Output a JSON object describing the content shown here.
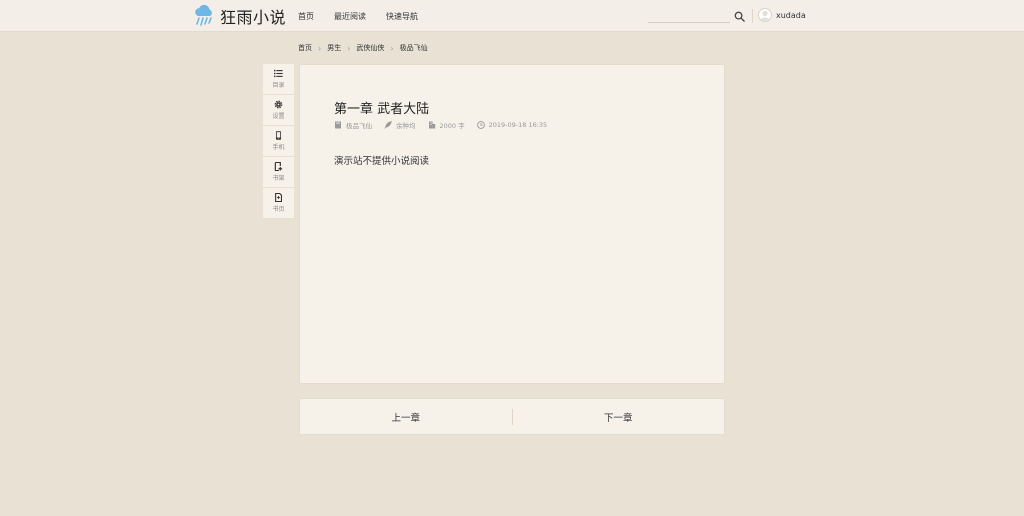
{
  "header": {
    "logo_text": "狂雨小说",
    "nav": [
      {
        "label": "首页"
      },
      {
        "label": "最近阅读"
      },
      {
        "label": "快速导航"
      }
    ],
    "search": {
      "placeholder": "",
      "value": ""
    },
    "user": {
      "name": "xudada"
    }
  },
  "breadcrumb": [
    "首页",
    "男生",
    "武侠仙侠",
    "极品飞仙"
  ],
  "sidebar": {
    "items": [
      {
        "label": "目录",
        "icon": "list-icon"
      },
      {
        "label": "设置",
        "icon": "gear-icon"
      },
      {
        "label": "手机",
        "icon": "phone-icon"
      },
      {
        "label": "书架",
        "icon": "bookmark-add-icon"
      },
      {
        "label": "书页",
        "icon": "book-page-icon"
      }
    ]
  },
  "chapter": {
    "title": "第一章 武者大陆",
    "book": "极品飞仙",
    "author": "余种均",
    "words": "2000 字",
    "time": "2019-09-18 16:35",
    "body": "演示站不提供小说阅读"
  },
  "pager": {
    "prev": "上一章",
    "next": "下一章"
  },
  "colors": {
    "background": "#e9e1d3",
    "panel": "#f6f2ea",
    "logo_blue": "#6fb8e6"
  }
}
